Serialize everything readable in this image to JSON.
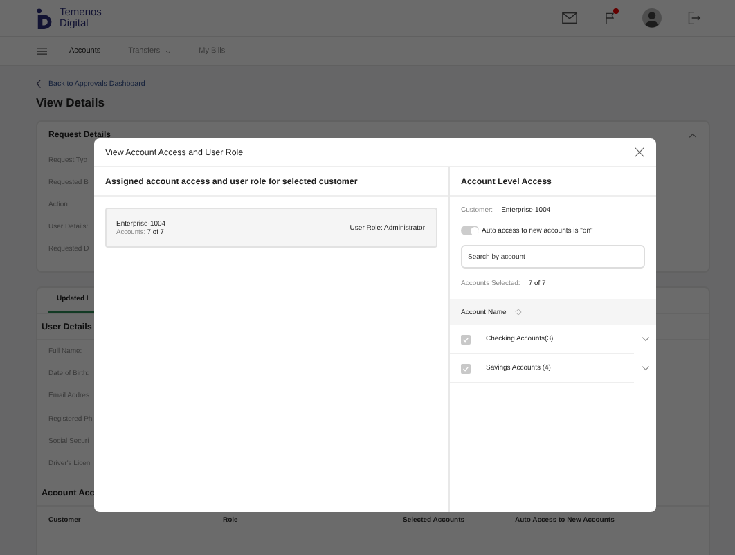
{
  "header": {
    "logo_lines": [
      "Temenos",
      "Digital"
    ],
    "has_notification": true
  },
  "nav": {
    "items": [
      {
        "label": "Accounts",
        "selected": true,
        "has_dropdown": false
      },
      {
        "label": "Transfers",
        "selected": false,
        "has_dropdown": true
      },
      {
        "label": "My Bills",
        "selected": false,
        "has_dropdown": false
      }
    ]
  },
  "back_link": "Back to Approvals Dashboard",
  "page_title": "View Details",
  "request_details": {
    "title": "Request Details",
    "fields": [
      "Request Typ",
      "Requested B",
      "Action",
      "User Details:",
      "Requested D"
    ]
  },
  "tabs": [
    {
      "label": "Updated I",
      "selected": true
    }
  ],
  "user_details": {
    "title": "User Details",
    "fields": [
      "Full Name:",
      "Date of Birth:",
      "Email Addres",
      "Registered Ph",
      "Social Securi",
      "Driver's Licen"
    ]
  },
  "account_access": {
    "title": "Account Acc",
    "columns": [
      "Customer",
      "Role",
      "Selected Accounts",
      "Auto Access to New Accounts"
    ]
  },
  "modal": {
    "title": "View Account Access and User Role",
    "left_heading": "Assigned account access and user role for selected customer",
    "customers": [
      {
        "name": "Enterprise-1004",
        "accounts_label": "Accounts:",
        "accounts_value": "7 of 7",
        "role_label": "User Role:",
        "role_value": "Administrator",
        "selected": true
      }
    ],
    "right": {
      "heading": "Account Level Access",
      "customer_label": "Customer:",
      "customer_value": "Enterprise-1004",
      "auto_access": {
        "label": "Auto access to new accounts is \"on\"",
        "on": true
      },
      "search": {
        "placeholder": "Search by account"
      },
      "accounts_selected_label": "Accounts Selected:",
      "accounts_selected_value": "7 of 7",
      "column": "Account Name",
      "rows": [
        {
          "label": "Checking Accounts(3)",
          "checked": true
        },
        {
          "label": "Savings Accounts (4)",
          "checked": true
        }
      ]
    }
  }
}
